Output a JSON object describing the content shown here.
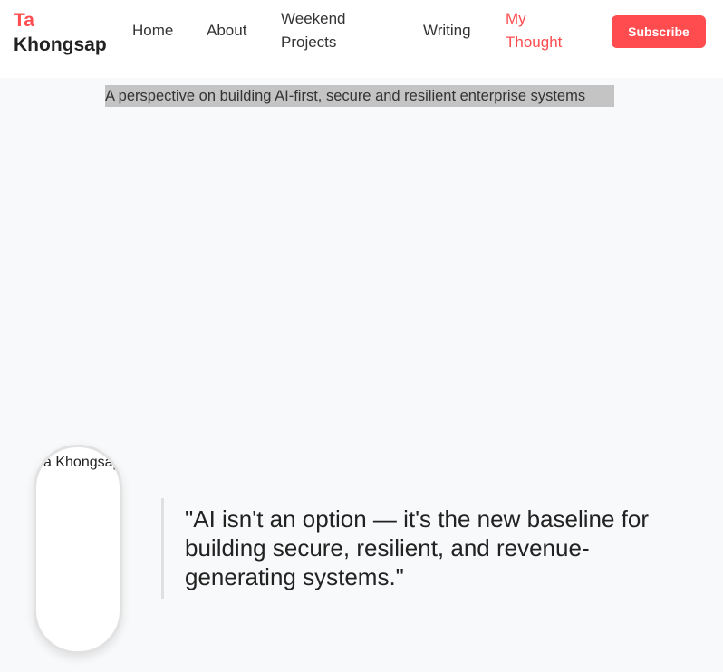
{
  "brand": {
    "first_name": "Ta",
    "last_name": "Khongsap",
    "accent_color": "#ff4d4f"
  },
  "nav": {
    "items": [
      {
        "label": "Home"
      },
      {
        "label": "About"
      },
      {
        "label": "Weekend Projects"
      },
      {
        "label": "Writing"
      },
      {
        "label": "My Thought",
        "active": true
      }
    ],
    "subscribe_label": "Subscribe"
  },
  "hero": {
    "tagline": "A perspective on building AI-first, secure and resilient enterprise systems"
  },
  "profile": {
    "image_alt": "Ta Khongsap"
  },
  "quote": {
    "text": "\"AI isn't an option — it's the new baseline for building secure, resilient, and revenue-generating systems.\""
  }
}
